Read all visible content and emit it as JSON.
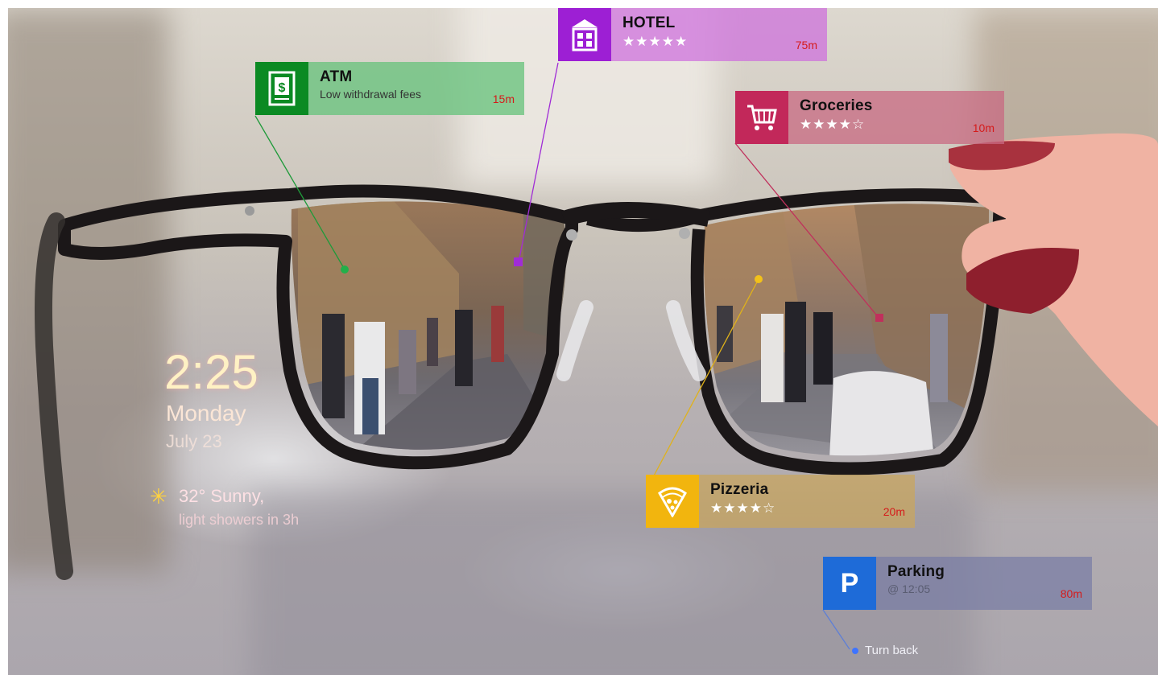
{
  "cards": {
    "atm": {
      "title": "ATM",
      "subtitle": "Low withdrawal fees",
      "distance": "15m",
      "icon": "atm-icon",
      "color": "#0b8a23"
    },
    "hotel": {
      "title": "HOTEL",
      "stars": "★★★★★",
      "distance": "75m",
      "icon": "hotel-icon",
      "color": "#9d1fd4"
    },
    "groceries": {
      "title": "Groceries",
      "stars": "★★★★☆",
      "distance": "10m",
      "icon": "shopping-cart-icon",
      "color": "#c2285a"
    },
    "pizzeria": {
      "title": "Pizzeria",
      "stars": "★★★★☆",
      "distance": "20m",
      "icon": "pizza-icon",
      "color": "#f2b50e"
    },
    "parking": {
      "title": "Parking",
      "subtitle": "@ 12:05",
      "distance": "80m",
      "icon": "parking-icon",
      "icon_text": "P",
      "color": "#1e6bd8"
    }
  },
  "hud": {
    "time": "2:25",
    "day": "Monday",
    "date": "July 23",
    "temperature": "32° Sunny,",
    "forecast": "light showers in 3h",
    "weather_icon": "sun-icon",
    "navigation": "Turn back"
  }
}
